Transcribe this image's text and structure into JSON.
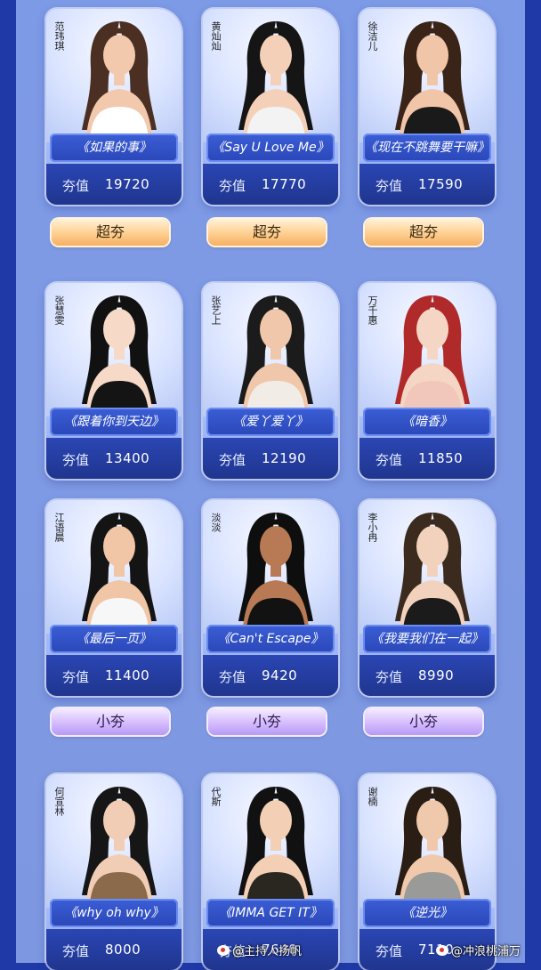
{
  "cards": [
    {
      "name": "范玮琪",
      "song": "《如果的事》",
      "label": "夯值",
      "score": "19720",
      "hair": "#4a2f22",
      "top": "#ffffff",
      "skin": "#f2c9ad"
    },
    {
      "name": "黄灿灿",
      "song": "《Say U Love Me》",
      "label": "夯值",
      "score": "17770",
      "hair": "#151515",
      "top": "#f3f3f3",
      "skin": "#f4d0b8"
    },
    {
      "name": "徐洁儿",
      "song": "《现在不跳舞要干嘛》",
      "label": "夯值",
      "score": "17590",
      "hair": "#3a2418",
      "top": "#1a1a1a",
      "skin": "#f1c6a8"
    },
    {
      "name": "张慧雯",
      "song": "《跟着你到天边》",
      "label": "夯值",
      "score": "13400",
      "hair": "#111111",
      "top": "#141414",
      "skin": "#f6d9c6"
    },
    {
      "name": "张艺上",
      "song": "《爱丫爱丫》",
      "label": "夯值",
      "score": "12190",
      "hair": "#1b1b1b",
      "top": "#f1ede6",
      "skin": "#f0c7aa"
    },
    {
      "name": "万千惠",
      "song": "《暗香》",
      "label": "夯值",
      "score": "11850",
      "hair": "#b02a2a",
      "top": "#f2c7bb",
      "skin": "#f5d6c4"
    },
    {
      "name": "江语晨",
      "song": "《最后一页》",
      "label": "夯值",
      "score": "11400",
      "hair": "#141414",
      "top": "#f7f7f7",
      "skin": "#f0c6a6"
    },
    {
      "name": "淡淡",
      "song": "《Can't Escape》",
      "label": "夯值",
      "score": "9420",
      "hair": "#0e0e0e",
      "top": "#121212",
      "skin": "#b87a55"
    },
    {
      "name": "李小冉",
      "song": "《我要我们在一起》",
      "label": "夯值",
      "score": "8990",
      "hair": "#3b2a1e",
      "top": "#1b1b1b",
      "skin": "#f3d2bd"
    },
    {
      "name": "何宣林",
      "song": "《why oh why》",
      "label": "夯值",
      "score": "8000",
      "hair": "#161616",
      "top": "#8a6a4a",
      "skin": "#f2cdb5"
    },
    {
      "name": "代斯",
      "song": "《IMMA GET IT》",
      "label": "夯值",
      "score": "7640",
      "hair": "#111111",
      "top": "#2a2620",
      "skin": "#f3cfb6"
    },
    {
      "name": "谢楠",
      "song": "《逆光》",
      "label": "夯值",
      "score": "7110",
      "hair": "#2a1d14",
      "top": "#9a9a98",
      "skin": "#f0c9ad"
    }
  ],
  "badges": {
    "gold": [
      "超夯",
      "超夯",
      "超夯"
    ],
    "purple": [
      "小夯",
      "小夯",
      "小夯"
    ]
  },
  "watermarks": {
    "left": "@主持人扬帆",
    "right": "@冲浪桃浦万"
  }
}
